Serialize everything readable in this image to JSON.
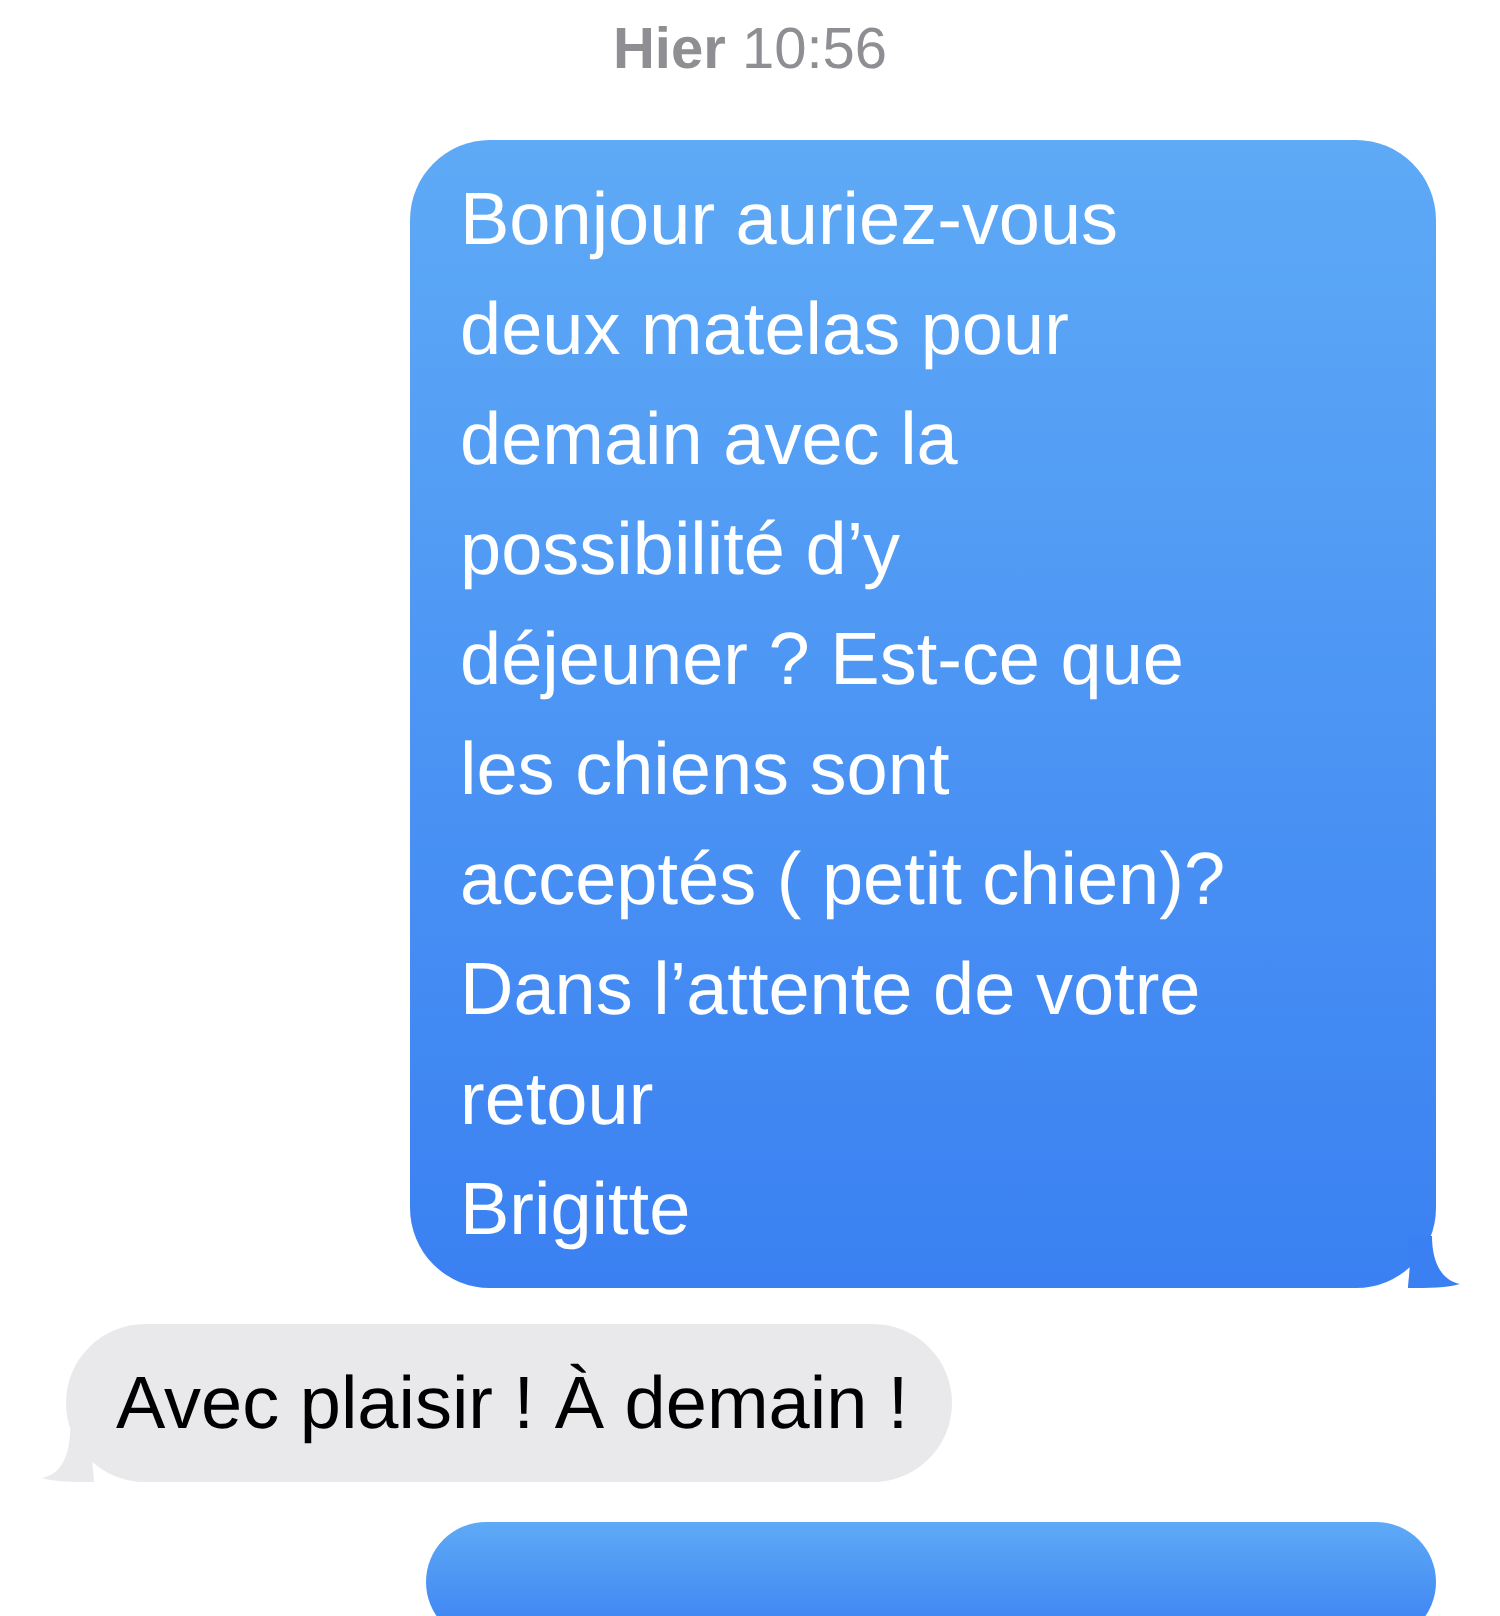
{
  "timestamp": "**Hier** 10:56",
  "messages": [
    {
      "kind": "sent",
      "text": "Bonjour auriez-vous\ndeux matelas pour\ndemain avec la\npossibilité d’y\ndéjeuner ? Est-ce que\nles chiens sont\nacceptés ( petit chien)?\nDans l’attente de votre\nretour\nBrigitte",
      "tail": true
    },
    {
      "kind": "received",
      "text": "Avec plaisir ! À demain !",
      "tail": true
    },
    {
      "kind": "sent",
      "tail": false
    }
  ]
}
